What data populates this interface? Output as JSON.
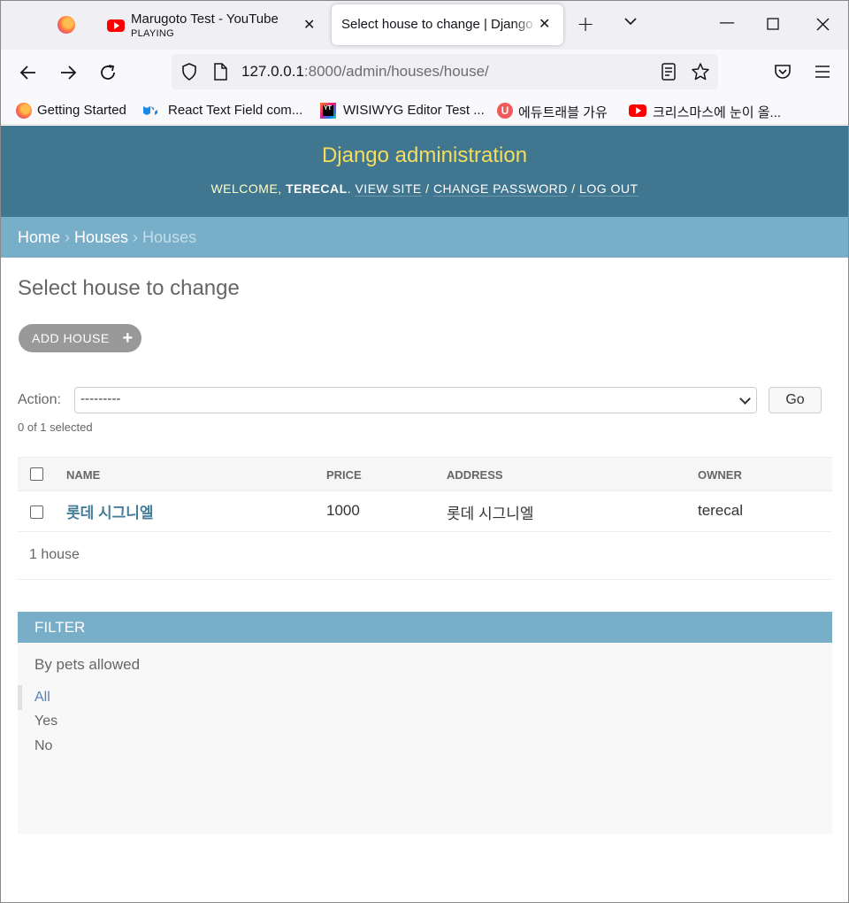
{
  "browser": {
    "tabs": [
      {
        "title": "Marugoto Test - YouTube",
        "subtitle": "PLAYING"
      },
      {
        "title": "Select house to change | Django site admin"
      }
    ],
    "url": {
      "host": "127.0.0.1",
      "path": ":8000/admin/houses/house/"
    },
    "bookmarks": [
      {
        "label": "Getting Started",
        "icon": "firefox-icon"
      },
      {
        "label": "React Text Field com...",
        "icon": "mui-icon"
      },
      {
        "label": "WISIWYG Editor Test ...",
        "icon": "jetbrains-icon"
      },
      {
        "label": "에듀트래블 가유",
        "icon": "eduf-icon"
      },
      {
        "label": "크리스마스에 눈이 올...",
        "icon": "youtube-icon"
      }
    ]
  },
  "admin": {
    "brand": "Django administration",
    "welcome": "WELCOME, ",
    "username": "TERECAL",
    "view_site": "View site",
    "change_password": "Change password",
    "log_out": "Log out",
    "sep": " / ",
    "breadcrumbs": {
      "home": "Home",
      "app": "Houses",
      "current": "Houses",
      "sep": " › "
    },
    "title": "Select house to change",
    "add_button": "ADD HOUSE",
    "action_label": "Action:",
    "action_value": "---------",
    "go_button": "Go",
    "selected_count": "0 of 1 selected",
    "columns": [
      "NAME",
      "PRICE",
      "ADDRESS",
      "OWNER"
    ],
    "rows": [
      {
        "name": "롯데 시그니엘",
        "price": "1000",
        "address": "롯데 시그니엘",
        "owner": "terecal"
      }
    ],
    "paginator": "1 house",
    "filter": {
      "heading": "FILTER",
      "by": "By pets allowed",
      "options": [
        "All",
        "Yes",
        "No"
      ],
      "selected": "All"
    }
  },
  "colors": {
    "header_bg": "#417690",
    "brand_text": "#f5dd5d",
    "breadcrumb_bg": "#79aec8",
    "link": "#447e9b"
  }
}
